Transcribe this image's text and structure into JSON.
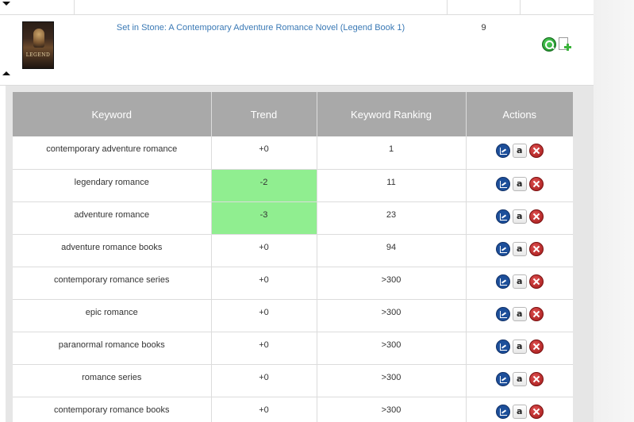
{
  "book": {
    "title": "Set in Stone: A Contemporary Adventure Romance Novel (Legend Book 1)",
    "count": "9",
    "cover_title": "LEGEND"
  },
  "icons": {
    "search": "search-icon",
    "add_document": "add-document-icon",
    "expand": "caret-down-icon",
    "collapse": "caret-up-icon",
    "chart": "chart-icon",
    "amazon": "amazon-icon",
    "delete": "delete-icon"
  },
  "keyword_table": {
    "headers": {
      "keyword": "Keyword",
      "trend": "Trend",
      "ranking": "Keyword Ranking",
      "actions": "Actions"
    },
    "amazon_label": "a",
    "rows": [
      {
        "keyword": "contemporary adventure romance",
        "trend": "+0",
        "ranking": "1"
      },
      {
        "keyword": "legendary romance",
        "trend": "-2",
        "ranking": "11"
      },
      {
        "keyword": "adventure romance",
        "trend": "-3",
        "ranking": "23"
      },
      {
        "keyword": "adventure romance books",
        "trend": "+0",
        "ranking": "94"
      },
      {
        "keyword": "contemporary romance series",
        "trend": "+0",
        "ranking": ">300"
      },
      {
        "keyword": "epic romance",
        "trend": "+0",
        "ranking": ">300"
      },
      {
        "keyword": "paranormal romance books",
        "trend": "+0",
        "ranking": ">300"
      },
      {
        "keyword": "romance series",
        "trend": "+0",
        "ranking": ">300"
      },
      {
        "keyword": "contemporary romance books",
        "trend": "+0",
        "ranking": ">300"
      }
    ]
  },
  "colors": {
    "header_bg": "#a9a9a9",
    "trend_negative_bg": "#90ee90",
    "link": "#3a79b5"
  }
}
